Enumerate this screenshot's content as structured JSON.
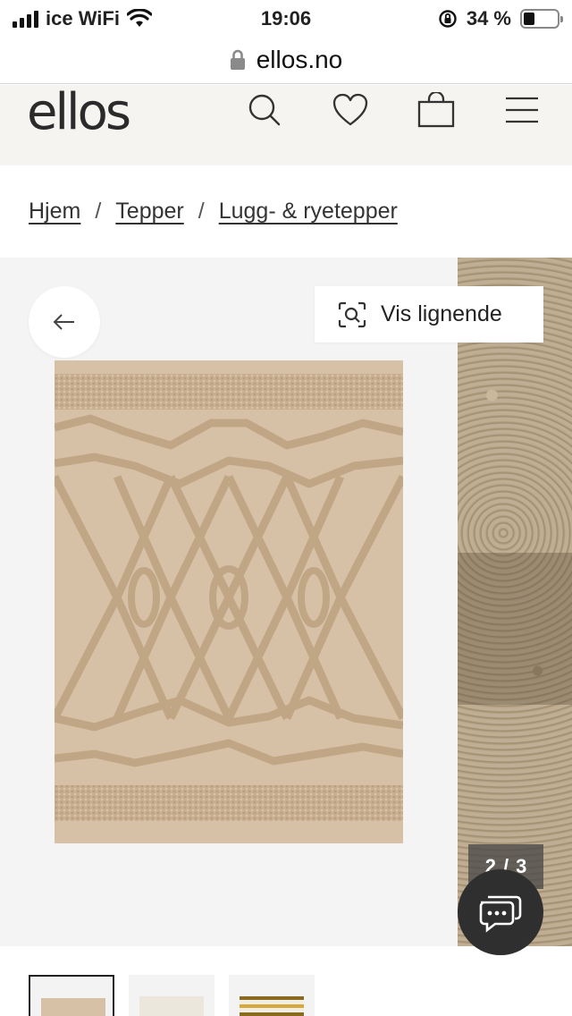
{
  "status_bar": {
    "carrier": "ice WiFi",
    "time": "19:06",
    "battery_percent": "34 %",
    "battery_level": 0.34
  },
  "browser": {
    "domain": "ellos.no"
  },
  "header": {
    "logo": "ellos",
    "icons": [
      "search-icon",
      "heart-icon",
      "bag-icon",
      "menu-icon"
    ]
  },
  "breadcrumb": {
    "items": [
      "Hjem",
      "Tepper",
      "Lugg- & ryetepper"
    ],
    "separator": "/"
  },
  "gallery": {
    "similar_label": "Vis lignende",
    "current": "2",
    "separator": "/",
    "total": "3"
  },
  "colors": {
    "header_bg": "#f6f4f0",
    "rug": "#d7c1a6",
    "rug_pattern": "#c4ab8c",
    "chat_bg": "#2f2f2f"
  },
  "thumbnails": [
    "beige-rug",
    "white-rug",
    "striped-rug"
  ]
}
